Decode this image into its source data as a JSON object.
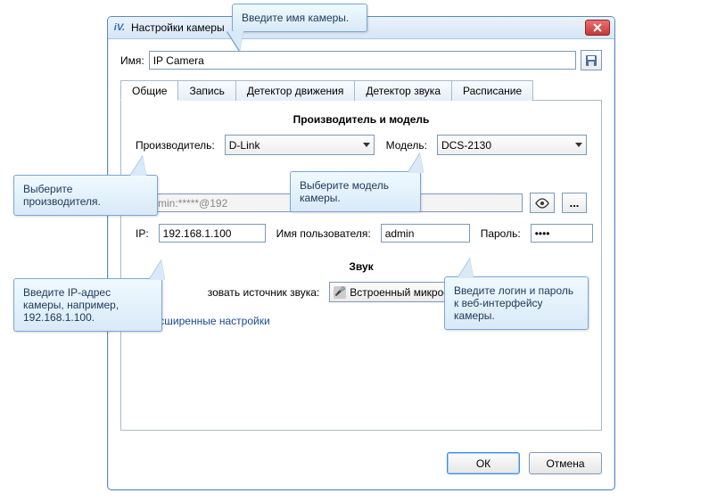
{
  "window": {
    "title": "Настройки камеры",
    "app_icon_text": "iV.",
    "close_btn": "close"
  },
  "name_row": {
    "label": "Имя:",
    "value": "IP Camera"
  },
  "tabs": [
    "Общие",
    "Запись",
    "Детектор движения",
    "Детектор звука",
    "Расписание"
  ],
  "general": {
    "section_title": "Производитель и модель",
    "manuf_label": "Производитель:",
    "manuf_value": "D-Link",
    "model_label": "Модель:",
    "model_value": "DCS-2130",
    "url_value": "//admin:*****@192",
    "ip_label": "IP:",
    "ip_value": "192.168.1.100",
    "user_label": "Имя пользователя:",
    "user_value": "admin",
    "pass_label": "Пароль:",
    "pass_value": "••••",
    "sound_title": "Звук",
    "sound_src_label": "зовать источник звука:",
    "sound_src_value": "Встроенный микрофон камеры",
    "dots": "...",
    "advanced": "Расширенные настройки"
  },
  "buttons": {
    "ok": "ОК",
    "cancel": "Отмена"
  },
  "callouts": {
    "name": "Введите имя камеры.",
    "manuf": "Выберите производителя.",
    "model": "Выберите модель камеры.",
    "ip": "Введите IP-адрес камеры, например, 192.168.1.100.",
    "login": "Введите логин и пароль к веб-интерфейсу камеры."
  }
}
